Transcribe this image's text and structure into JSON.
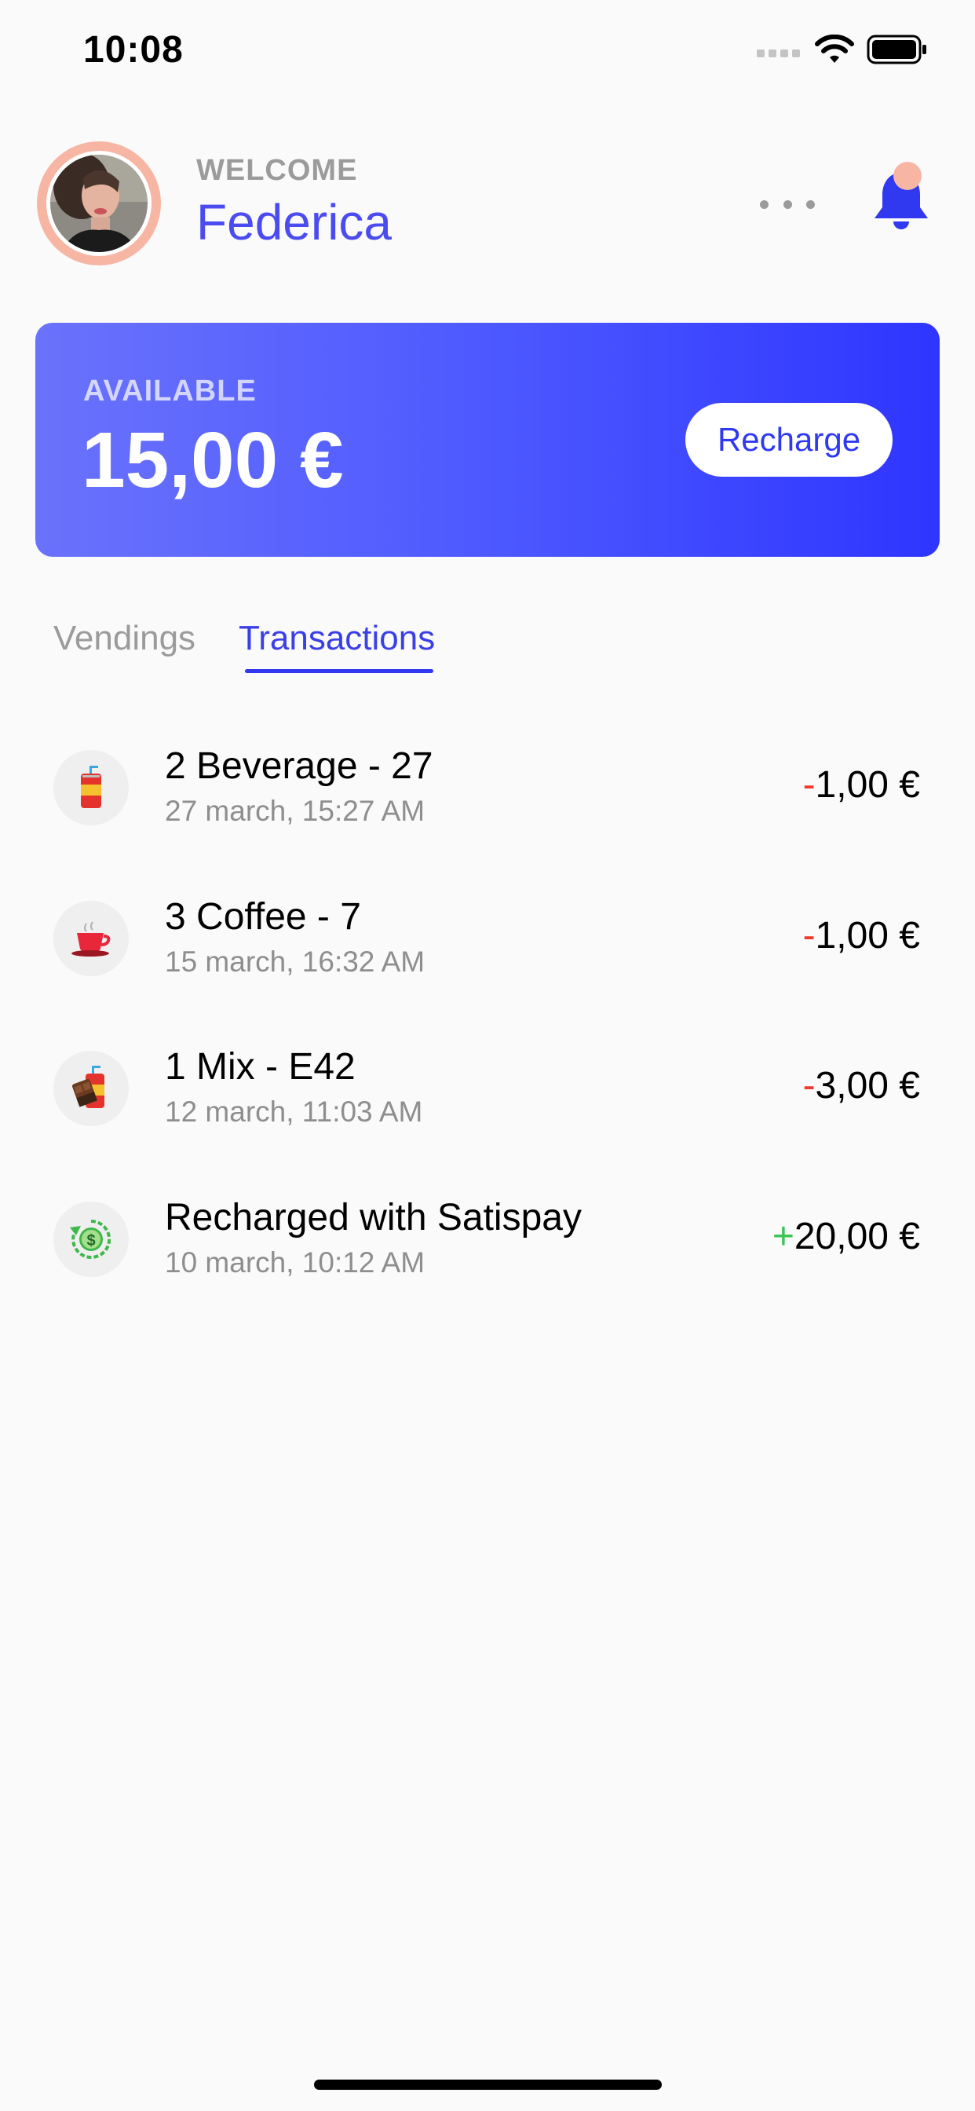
{
  "status_bar": {
    "time": "10:08",
    "icons": [
      "signal-icon",
      "wifi-icon",
      "battery-icon"
    ]
  },
  "header": {
    "welcome": "WELCOME",
    "name": "Federica",
    "avatar_ring_color": "#f7b6a3",
    "accent_color": "#4a4cf0"
  },
  "balance": {
    "label": "AVAILABLE",
    "amount": "15,00 €",
    "recharge_label": "Recharge"
  },
  "tabs": [
    {
      "label": "Vendings",
      "active": false
    },
    {
      "label": "Transactions",
      "active": true
    }
  ],
  "transactions": [
    {
      "title": "2 Beverage - 27",
      "date": "27 march, 15:27 AM",
      "sign": "-",
      "amount": "1,00 €",
      "icon": "beverage-can-icon"
    },
    {
      "title": "3 Coffee - 7",
      "date": "15 march, 16:32 AM",
      "sign": "-",
      "amount": "1,00 €",
      "icon": "coffee-cup-icon"
    },
    {
      "title": "1 Mix - E42",
      "date": "12 march, 11:03 AM",
      "sign": "-",
      "amount": "3,00 €",
      "icon": "mix-snack-icon"
    },
    {
      "title": "Recharged with Satispay",
      "date": "10 march, 10:12 AM",
      "sign": "+",
      "amount": "20,00 €",
      "icon": "recharge-dollar-icon"
    }
  ],
  "colors": {
    "negative": "#ee3b2a",
    "positive": "#3fc45a",
    "card_gradient_start": "#6a72fb",
    "card_gradient_end": "#2e35ff"
  }
}
